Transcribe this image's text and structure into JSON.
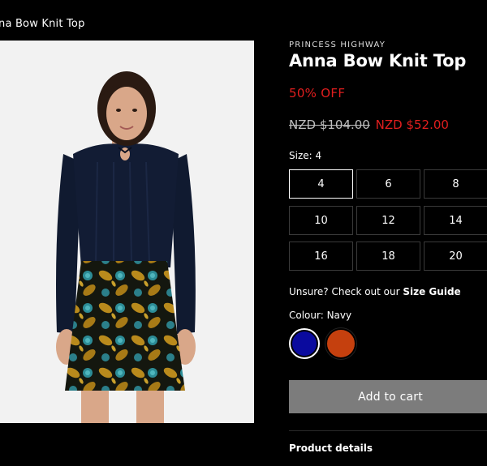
{
  "breadcrumb": "na Bow Knit Top",
  "product": {
    "brand": "PRINCESS HIGHWAY",
    "title": "Anna Bow Knit Top",
    "discount": "50% OFF",
    "old_price": "NZD $104.00",
    "new_price": "NZD $52.00"
  },
  "size": {
    "label": "Size: 4",
    "options": [
      "4",
      "6",
      "8",
      "10",
      "12",
      "14",
      "16",
      "18",
      "20"
    ],
    "selected": "4"
  },
  "size_guide": {
    "prefix": "Unsure? Check out our ",
    "link": "Size Guide"
  },
  "colour": {
    "label": "Colour: Navy",
    "swatches": [
      {
        "name": "Navy",
        "color": "#0a0a9e",
        "selected": true
      },
      {
        "name": "Rust",
        "color": "#c5400e",
        "selected": false
      }
    ]
  },
  "add_to_cart": "Add to cart",
  "product_details": "Product details",
  "colors": {
    "sale": "#e01e1e",
    "background": "#000000",
    "button": "#7c7c7c"
  }
}
